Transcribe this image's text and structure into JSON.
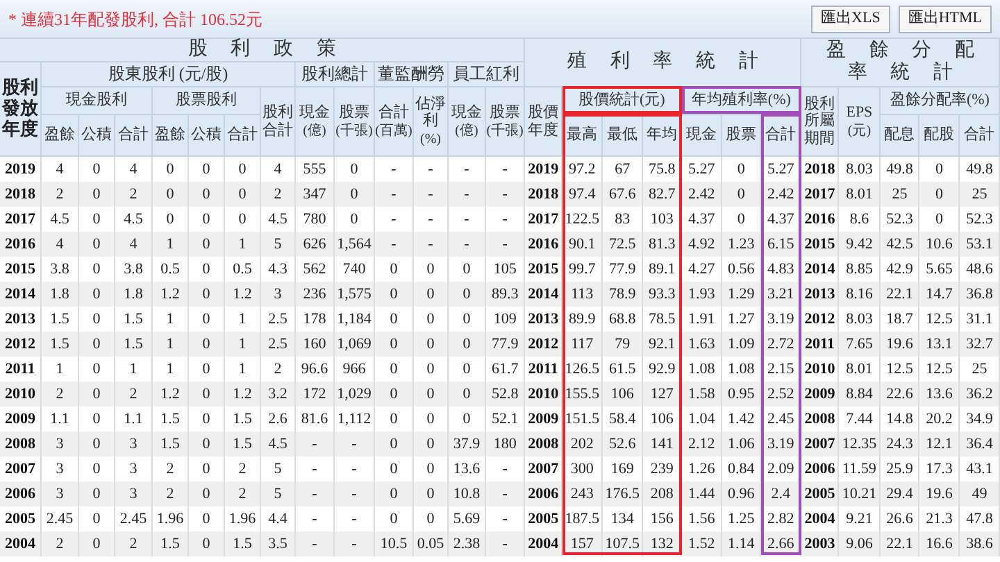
{
  "notice": "* 連續31年配發股利, 合計 106.52元",
  "buttons": [
    "匯出XLS",
    "匯出HTML"
  ],
  "header_rows": [
    [
      {
        "label": "股利政策"
      },
      {
        "label": "殖利率統計"
      },
      {
        "label": "盈餘分配率統計"
      }
    ],
    [
      {
        "label": "股利發放年度"
      },
      {
        "label": "股東股利 (元/股)"
      },
      {
        "label": "股利總計"
      },
      {
        "label": "董監酬勞"
      },
      {
        "label": "員工紅利"
      }
    ],
    [
      {
        "label": "現金股利"
      },
      {
        "label": "股票股利"
      },
      {
        "label": "股利合計"
      },
      {
        "label": "現金",
        "unit": "(億)"
      },
      {
        "label": "股票",
        "unit": "(千張)"
      },
      {
        "label": "合計",
        "unit": "(百萬)"
      },
      {
        "label": "佔淨利",
        "unit": "(%)"
      },
      {
        "label": "現金",
        "unit": "(億)"
      },
      {
        "label": "股票",
        "unit": "(千張)"
      },
      {
        "label": "股價年度"
      },
      {
        "label": "股價統計(元)",
        "color": "#e8242c"
      },
      {
        "label": "年均殖利率(%)",
        "color": "#a04fb8"
      },
      {
        "label": "股利所屬期間"
      },
      {
        "label": "EPS",
        "unit": "(元)"
      },
      {
        "label": "盈餘分配率(%)"
      }
    ],
    [
      {
        "label": "盈餘"
      },
      {
        "label": "公積"
      },
      {
        "label": "合計"
      },
      {
        "label": "盈餘"
      },
      {
        "label": "公積"
      },
      {
        "label": "合計"
      },
      {
        "label": "最高",
        "color": "#e8242c"
      },
      {
        "label": "最低",
        "color": "#e8242c"
      },
      {
        "label": "年均",
        "color": "#e8242c"
      },
      {
        "label": "現金"
      },
      {
        "label": "股票"
      },
      {
        "label": "合計",
        "color": "#a04fb8"
      },
      {
        "label": "配息"
      },
      {
        "label": "配股"
      },
      {
        "label": "合計"
      }
    ]
  ],
  "rows": [
    [
      "2019",
      "4",
      "0",
      "4",
      "0",
      "0",
      "0",
      "4",
      "555",
      "0",
      "-",
      "-",
      "-",
      "-",
      "2019",
      "97.2",
      "67",
      "75.8",
      "5.27",
      "0",
      "5.27",
      "2018",
      "8.03",
      "49.8",
      "0",
      "49.8"
    ],
    [
      "2018",
      "2",
      "0",
      "2",
      "0",
      "0",
      "0",
      "2",
      "347",
      "0",
      "-",
      "-",
      "-",
      "-",
      "2018",
      "97.4",
      "67.6",
      "82.7",
      "2.42",
      "0",
      "2.42",
      "2017",
      "8.01",
      "25",
      "0",
      "25"
    ],
    [
      "2017",
      "4.5",
      "0",
      "4.5",
      "0",
      "0",
      "0",
      "4.5",
      "780",
      "0",
      "-",
      "-",
      "-",
      "-",
      "2017",
      "122.5",
      "83",
      "103",
      "4.37",
      "0",
      "4.37",
      "2016",
      "8.6",
      "52.3",
      "0",
      "52.3"
    ],
    [
      "2016",
      "4",
      "0",
      "4",
      "1",
      "0",
      "1",
      "5",
      "626",
      "1,564",
      "-",
      "-",
      "-",
      "-",
      "2016",
      "90.1",
      "72.5",
      "81.3",
      "4.92",
      "1.23",
      "6.15",
      "2015",
      "9.42",
      "42.5",
      "10.6",
      "53.1"
    ],
    [
      "2015",
      "3.8",
      "0",
      "3.8",
      "0.5",
      "0",
      "0.5",
      "4.3",
      "562",
      "740",
      "0",
      "0",
      "0",
      "105",
      "2015",
      "99.7",
      "77.9",
      "89.1",
      "4.27",
      "0.56",
      "4.83",
      "2014",
      "8.85",
      "42.9",
      "5.65",
      "48.6"
    ],
    [
      "2014",
      "1.8",
      "0",
      "1.8",
      "1.2",
      "0",
      "1.2",
      "3",
      "236",
      "1,575",
      "0",
      "0",
      "0",
      "89.3",
      "2014",
      "113",
      "78.9",
      "93.3",
      "1.93",
      "1.29",
      "3.21",
      "2013",
      "8.16",
      "22.1",
      "14.7",
      "36.8"
    ],
    [
      "2013",
      "1.5",
      "0",
      "1.5",
      "1",
      "0",
      "1",
      "2.5",
      "178",
      "1,184",
      "0",
      "0",
      "0",
      "109",
      "2013",
      "89.9",
      "68.8",
      "78.5",
      "1.91",
      "1.27",
      "3.19",
      "2012",
      "8.03",
      "18.7",
      "12.5",
      "31.1"
    ],
    [
      "2012",
      "1.5",
      "0",
      "1.5",
      "1",
      "0",
      "1",
      "2.5",
      "160",
      "1,069",
      "0",
      "0",
      "0",
      "77.9",
      "2012",
      "117",
      "79",
      "92.1",
      "1.63",
      "1.09",
      "2.72",
      "2011",
      "7.65",
      "19.6",
      "13.1",
      "32.7"
    ],
    [
      "2011",
      "1",
      "0",
      "1",
      "1",
      "0",
      "1",
      "2",
      "96.6",
      "966",
      "0",
      "0",
      "0",
      "61.7",
      "2011",
      "126.5",
      "61.5",
      "92.9",
      "1.08",
      "1.08",
      "2.15",
      "2010",
      "8.01",
      "12.5",
      "12.5",
      "25"
    ],
    [
      "2010",
      "2",
      "0",
      "2",
      "1.2",
      "0",
      "1.2",
      "3.2",
      "172",
      "1,029",
      "0",
      "0",
      "0",
      "52.8",
      "2010",
      "155.5",
      "106",
      "127",
      "1.58",
      "0.95",
      "2.52",
      "2009",
      "8.84",
      "22.6",
      "13.6",
      "36.2"
    ],
    [
      "2009",
      "1.1",
      "0",
      "1.1",
      "1.5",
      "0",
      "1.5",
      "2.6",
      "81.6",
      "1,112",
      "0",
      "0",
      "0",
      "52.1",
      "2009",
      "151.5",
      "58.4",
      "106",
      "1.04",
      "1.42",
      "2.45",
      "2008",
      "7.44",
      "14.8",
      "20.2",
      "34.9"
    ],
    [
      "2008",
      "3",
      "0",
      "3",
      "1.5",
      "0",
      "1.5",
      "4.5",
      "-",
      "-",
      "0",
      "0",
      "37.9",
      "180",
      "2008",
      "202",
      "52.6",
      "141",
      "2.12",
      "1.06",
      "3.19",
      "2007",
      "12.35",
      "24.3",
      "12.1",
      "36.4"
    ],
    [
      "2007",
      "3",
      "0",
      "3",
      "2",
      "0",
      "2",
      "5",
      "-",
      "-",
      "0",
      "0",
      "13.6",
      "-",
      "2007",
      "300",
      "169",
      "239",
      "1.26",
      "0.84",
      "2.09",
      "2006",
      "11.59",
      "25.9",
      "17.3",
      "43.1"
    ],
    [
      "2006",
      "3",
      "0",
      "3",
      "2",
      "0",
      "2",
      "5",
      "-",
      "-",
      "0",
      "0",
      "10.8",
      "-",
      "2006",
      "243",
      "176.5",
      "208",
      "1.44",
      "0.96",
      "2.4",
      "2005",
      "10.21",
      "29.4",
      "19.6",
      "49"
    ],
    [
      "2005",
      "2.45",
      "0",
      "2.45",
      "1.96",
      "0",
      "1.96",
      "4.4",
      "-",
      "-",
      "0",
      "0",
      "5.69",
      "-",
      "2005",
      "187.5",
      "134",
      "156",
      "1.56",
      "1.25",
      "2.82",
      "2004",
      "9.21",
      "26.6",
      "21.3",
      "47.8"
    ],
    [
      "2004",
      "2",
      "0",
      "2",
      "1.5",
      "0",
      "1.5",
      "3.5",
      "-",
      "-",
      "10.5",
      "0.05",
      "2.38",
      "-",
      "2004",
      "157",
      "107.5",
      "132",
      "1.52",
      "1.14",
      "2.66",
      "2003",
      "9.06",
      "22.1",
      "16.6",
      "38.6"
    ]
  ]
}
